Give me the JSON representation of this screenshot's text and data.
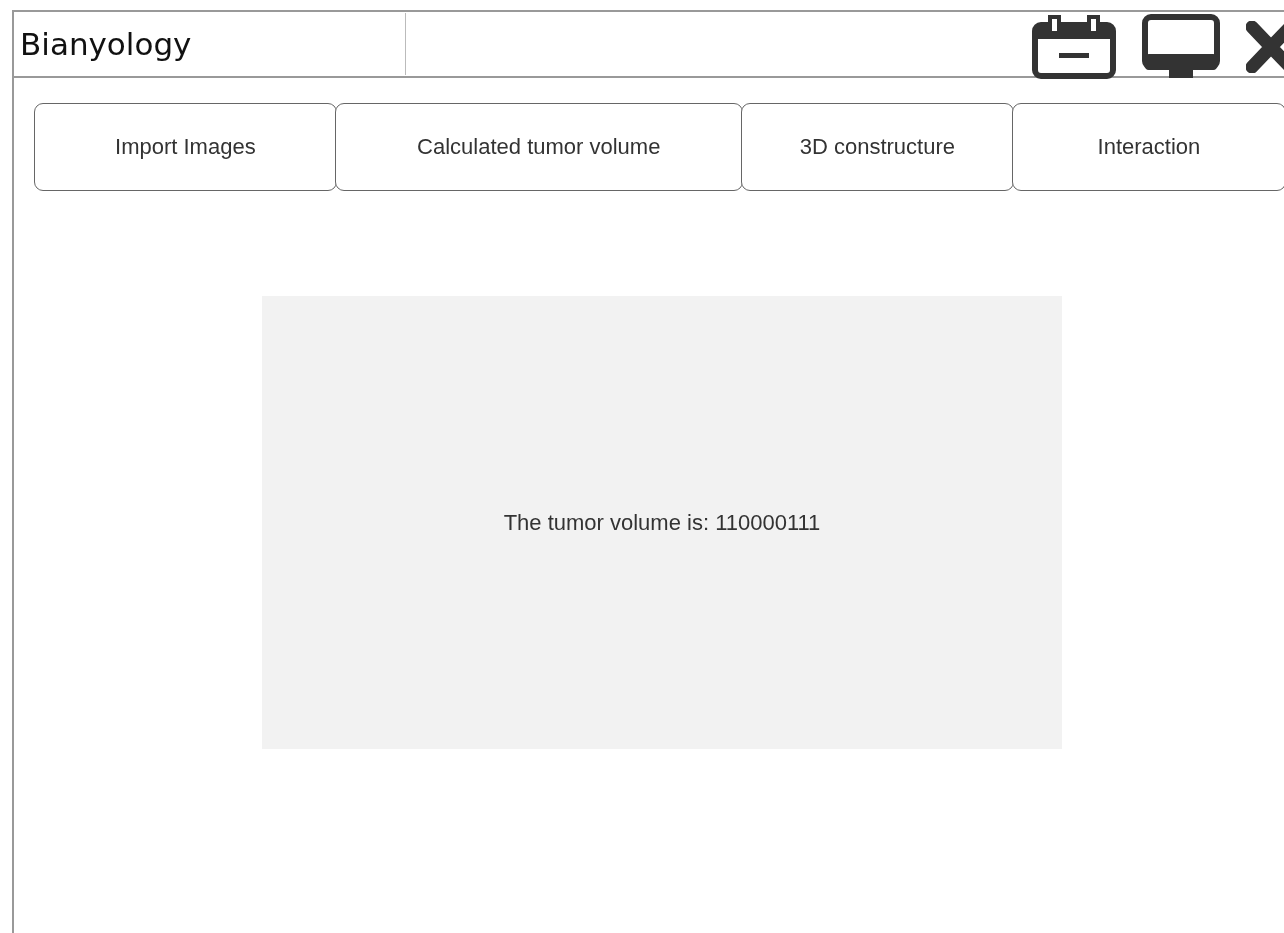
{
  "window": {
    "title": "Bianyology"
  },
  "buttons": [
    {
      "label": "Import Images"
    },
    {
      "label": "Calculated tumor volume"
    },
    {
      "label": "3D constructure"
    },
    {
      "label": "Interaction"
    }
  ],
  "result": {
    "text": "The tumor volume is: 110000111"
  }
}
